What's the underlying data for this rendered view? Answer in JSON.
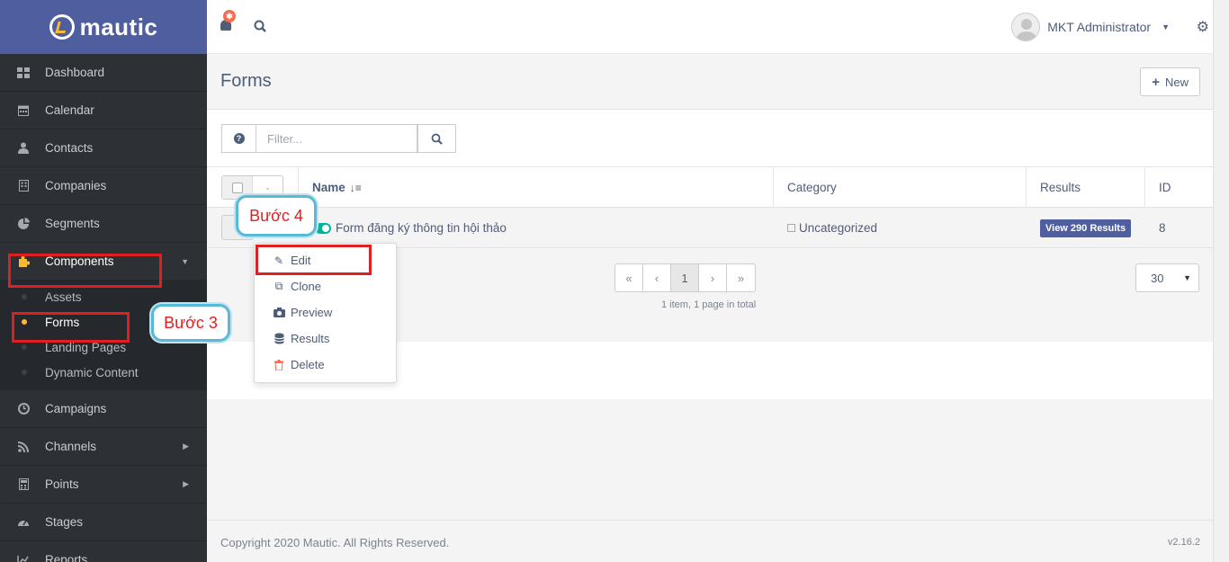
{
  "brand": {
    "name": "mautic"
  },
  "sidebar": {
    "items": [
      {
        "label": "Dashboard",
        "icon": "dashboard-icon"
      },
      {
        "label": "Calendar",
        "icon": "calendar-icon"
      },
      {
        "label": "Contacts",
        "icon": "user-icon"
      },
      {
        "label": "Companies",
        "icon": "building-icon"
      },
      {
        "label": "Segments",
        "icon": "pie-chart-icon"
      },
      {
        "label": "Components",
        "icon": "puzzle-icon"
      },
      {
        "label": "Campaigns",
        "icon": "clock-icon"
      },
      {
        "label": "Channels",
        "icon": "rss-icon"
      },
      {
        "label": "Points",
        "icon": "calculator-icon"
      },
      {
        "label": "Stages",
        "icon": "tachometer-icon"
      },
      {
        "label": "Reports",
        "icon": "line-chart-icon"
      }
    ],
    "sub_items": [
      "Assets",
      "Forms",
      "Landing Pages",
      "Dynamic Content"
    ]
  },
  "header": {
    "notification_badge": "✱",
    "user_name": "MKT Administrator"
  },
  "page": {
    "title": "Forms",
    "new_button": "New"
  },
  "filter": {
    "placeholder": "Filter..."
  },
  "table": {
    "columns": [
      "Name",
      "Category",
      "Results",
      "ID"
    ],
    "rows": [
      {
        "name": "Form đăng ký thông tin hội thảo",
        "category": "Uncategorized",
        "results": "View 290 Results",
        "id": "8"
      }
    ]
  },
  "row_menu": [
    "Edit",
    "Clone",
    "Preview",
    "Results",
    "Delete"
  ],
  "pagination": {
    "first": "«",
    "prev": "‹",
    "current": "1",
    "next": "›",
    "last": "»",
    "info": "1 item, 1 page in total",
    "per_page": "30"
  },
  "callouts": {
    "step3": "Bước 3",
    "step4": "Bước 4"
  },
  "footer": {
    "copyright": "Copyright 2020 Mautic. All Rights Reserved.",
    "version": "v2.16.2"
  },
  "colors": {
    "brand": "#4e5e9e",
    "sidebar": "#2d3035",
    "accent": "#fdb933",
    "toggle": "#00b49c",
    "highlight": "#e02020",
    "callout_border": "#5bb8d6"
  }
}
